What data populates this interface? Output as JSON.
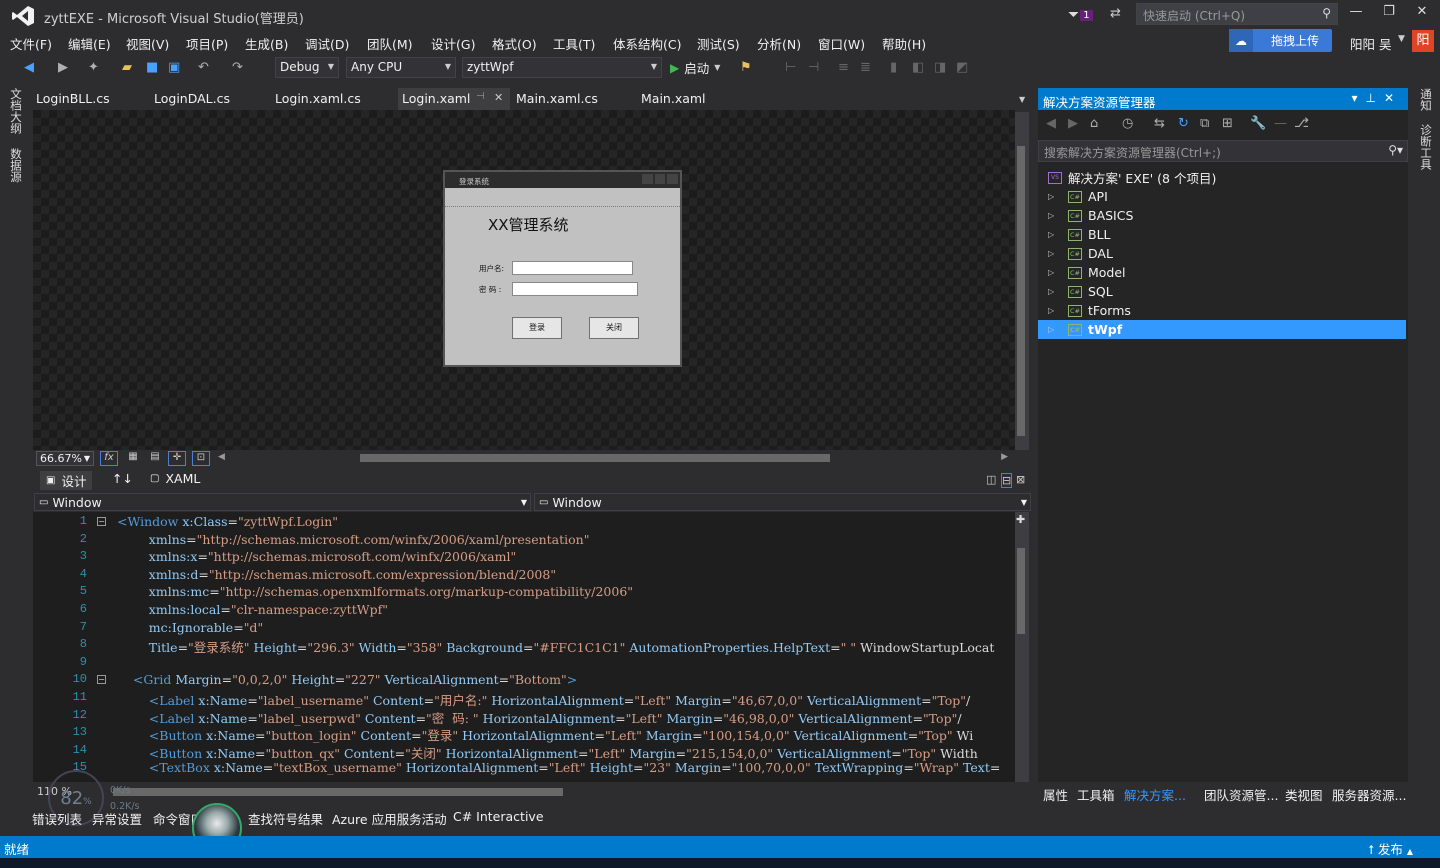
{
  "window": {
    "title": "zyttEXE - Microsoft Visual Studio(管理员)",
    "notification_count": "1",
    "quick_launch_placeholder": "快速启动 (Ctrl+Q)",
    "minimize_icon": "minimize-icon",
    "maximize_icon": "maximize-icon",
    "close_icon": "close-icon"
  },
  "menu": {
    "items": [
      "文件(F)",
      "编辑(E)",
      "视图(V)",
      "项目(P)",
      "生成(B)",
      "调试(D)",
      "团队(M)",
      "设计(G)",
      "格式(O)",
      "工具(T)",
      "体系结构(C)",
      "测试(S)",
      "分析(N)",
      "窗口(W)",
      "帮助(H)"
    ],
    "upload_label": "拖拽上传",
    "user_name": "阳阳 吴",
    "user_avatar_char": "阳"
  },
  "toolbar": {
    "config": "Debug",
    "platform": "Any CPU",
    "startup_project": "zyttWpf",
    "start_label": "启动"
  },
  "left_strip": {
    "tabs": [
      "文档大纲",
      "数据源"
    ]
  },
  "right_strip": {
    "tabs": [
      "通知",
      "诊断工具"
    ]
  },
  "doc_tabs": [
    {
      "label": "LoginBLL.cs"
    },
    {
      "label": "LoginDAL.cs"
    },
    {
      "label": "Login.xaml.cs"
    },
    {
      "label": "Login.xaml"
    },
    {
      "label": "Main.xaml.cs"
    },
    {
      "label": "Main.xaml"
    }
  ],
  "designer": {
    "login_window": {
      "title": "登录系统",
      "heading": "XX管理系统",
      "username_label": "用户名:",
      "password_label": "密  码 :",
      "login_button": "登录",
      "close_button": "关闭"
    },
    "zoom": "66.67%",
    "fx_label": "fx"
  },
  "split": {
    "design_tab": "设计",
    "swap_icon": "↑↓",
    "xaml_tab": "XAML"
  },
  "navbar": {
    "left": "Window",
    "right": "Window"
  },
  "code": {
    "lines": [
      {
        "n": "1",
        "t": "<Window x:Class=\"zyttWpf.Login\""
      },
      {
        "n": "2",
        "t": "        xmlns=\"http://schemas.microsoft.com/winfx/2006/xaml/presentation\""
      },
      {
        "n": "3",
        "t": "        xmlns:x=\"http://schemas.microsoft.com/winfx/2006/xaml\""
      },
      {
        "n": "4",
        "t": "        xmlns:d=\"http://schemas.microsoft.com/expression/blend/2008\""
      },
      {
        "n": "5",
        "t": "        xmlns:mc=\"http://schemas.openxmlformats.org/markup-compatibility/2006\""
      },
      {
        "n": "6",
        "t": "        xmlns:local=\"clr-namespace:zyttWpf\""
      },
      {
        "n": "7",
        "t": "        mc:Ignorable=\"d\""
      },
      {
        "n": "8",
        "t": "        Title=\"登录系统\" Height=\"296.3\" Width=\"358\" Background=\"#FFC1C1C1\" AutomationProperties.HelpText=\" \" WindowStartupLocat"
      },
      {
        "n": "9",
        "t": ""
      },
      {
        "n": "10",
        "t": "    <Grid Margin=\"0,0,2,0\" Height=\"227\" VerticalAlignment=\"Bottom\">"
      },
      {
        "n": "11",
        "t": "        <Label x:Name=\"label_username\" Content=\"用户名:\" HorizontalAlignment=\"Left\" Margin=\"46,67,0,0\" VerticalAlignment=\"Top\"/"
      },
      {
        "n": "12",
        "t": "        <Label x:Name=\"label_userpwd\" Content=\"密  码: \" HorizontalAlignment=\"Left\" Margin=\"46,98,0,0\" VerticalAlignment=\"Top\"/"
      },
      {
        "n": "13",
        "t": "        <Button x:Name=\"button_login\" Content=\"登录\" HorizontalAlignment=\"Left\" Margin=\"100,154,0,0\" VerticalAlignment=\"Top\" Wi"
      },
      {
        "n": "14",
        "t": "        <Button x:Name=\"button_qx\" Content=\"关闭\" HorizontalAlignment=\"Left\" Margin=\"215,154,0,0\" VerticalAlignment=\"Top\" Width"
      },
      {
        "n": "15",
        "t": "        <TextBox x:Name=\"textBox_username\" HorizontalAlignment=\"Left\" Height=\"23\" Margin=\"100,70,0,0\" TextWrapping=\"Wrap\" Text="
      }
    ],
    "zoom": "110 %"
  },
  "net_widget": {
    "percent": "82",
    "up": "0K/s",
    "down": "0.2K/s"
  },
  "bottom_tabs": [
    "错误列表",
    "异常设置",
    "命令窗口",
    "查找符号结果",
    "Azure 应用服务活动",
    "C# Interactive"
  ],
  "status": {
    "text": "就绪",
    "publish": "发布"
  },
  "solution_explorer": {
    "title": "解决方案资源管理器",
    "search_placeholder": "搜索解决方案资源管理器(Ctrl+;)",
    "solution": "解决方案'        EXE' (8 个项目)",
    "projects": [
      "API",
      "BASICS",
      "BLL",
      "DAL",
      "Model",
      "SQL",
      "    tForms",
      "    tWpf"
    ],
    "selected_index": 7
  },
  "right_bottom_tabs": [
    "属性",
    "工具箱",
    "解决方案...",
    "团队资源管...",
    "类视图",
    "服务器资源..."
  ],
  "colors": {
    "accent": "#007acc",
    "selection": "#3399ff",
    "background": "#2d2d30"
  }
}
